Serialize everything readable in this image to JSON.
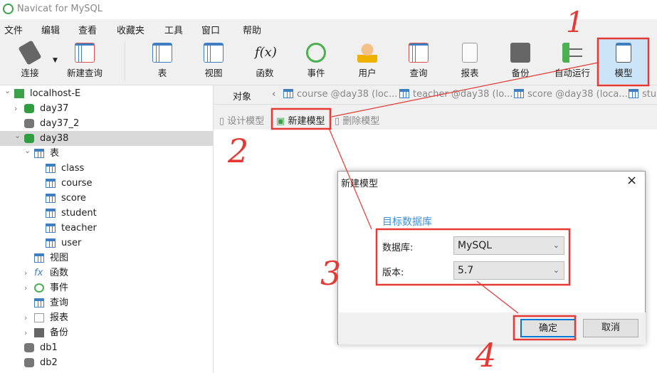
{
  "window": {
    "title": "Navicat for MySQL"
  },
  "menu": [
    "文件",
    "编辑",
    "查看",
    "收藏夹",
    "工具",
    "窗口",
    "帮助"
  ],
  "toolbar": [
    {
      "label": "连接",
      "icon": "connect-icon"
    },
    {
      "label": "新建查询",
      "icon": "new-query-icon"
    },
    {
      "label": "表",
      "icon": "table-icon"
    },
    {
      "label": "视图",
      "icon": "view-icon"
    },
    {
      "label": "函数",
      "icon": "function-icon"
    },
    {
      "label": "事件",
      "icon": "event-clock-icon"
    },
    {
      "label": "用户",
      "icon": "user-icon"
    },
    {
      "label": "查询",
      "icon": "query-icon"
    },
    {
      "label": "报表",
      "icon": "report-icon"
    },
    {
      "label": "备份",
      "icon": "backup-icon"
    },
    {
      "label": "自动运行",
      "icon": "auto-run-icon"
    },
    {
      "label": "模型",
      "icon": "model-icon",
      "active": true
    }
  ],
  "tree": [
    {
      "label": "localhost-E",
      "level": 0,
      "arrow": "v",
      "icon": "connection"
    },
    {
      "label": "day37",
      "level": 1,
      "arrow": ">",
      "icon": "db-green"
    },
    {
      "label": "day37_2",
      "level": 1,
      "arrow": "",
      "icon": "db-gray"
    },
    {
      "label": "day38",
      "level": 1,
      "arrow": "v",
      "icon": "db-green",
      "selected": true
    },
    {
      "label": "表",
      "level": 2,
      "arrow": "v",
      "icon": "table"
    },
    {
      "label": "class",
      "level": 3,
      "arrow": "",
      "icon": "table"
    },
    {
      "label": "course",
      "level": 3,
      "arrow": "",
      "icon": "table"
    },
    {
      "label": "score",
      "level": 3,
      "arrow": "",
      "icon": "table"
    },
    {
      "label": "student",
      "level": 3,
      "arrow": "",
      "icon": "table"
    },
    {
      "label": "teacher",
      "level": 3,
      "arrow": "",
      "icon": "table"
    },
    {
      "label": "user",
      "level": 3,
      "arrow": "",
      "icon": "table"
    },
    {
      "label": "视图",
      "level": 2,
      "arrow": "",
      "icon": "view"
    },
    {
      "label": "函数",
      "level": 2,
      "arrow": ">",
      "icon": "function"
    },
    {
      "label": "事件",
      "level": 2,
      "arrow": ">",
      "icon": "event"
    },
    {
      "label": "查询",
      "level": 2,
      "arrow": "",
      "icon": "query"
    },
    {
      "label": "报表",
      "level": 2,
      "arrow": ">",
      "icon": "report"
    },
    {
      "label": "备份",
      "level": 2,
      "arrow": ">",
      "icon": "backup"
    },
    {
      "label": "db1",
      "level": 1,
      "arrow": "",
      "icon": "db-gray"
    },
    {
      "label": "db2",
      "level": 1,
      "arrow": "",
      "icon": "db-gray"
    }
  ],
  "tabs": {
    "objects": "对象",
    "items": [
      "course @day38 (loc...",
      "teacher @day38 (lo...",
      "score @day38 (loca...",
      "stu"
    ]
  },
  "subtoolbar": {
    "design": "设计模型",
    "new": "新建模型",
    "delete": "删除模型"
  },
  "dialog": {
    "title": "新建模型",
    "section": "目标数据库",
    "db_label": "数据库:",
    "db_value": "MySQL",
    "ver_label": "版本:",
    "ver_value": "5.7",
    "ok": "确定",
    "cancel": "取消"
  },
  "annotations": [
    "1",
    "2",
    "3",
    "4"
  ],
  "colors": {
    "annotation": "#e53935",
    "accent": "#3d8fd6",
    "active_bg": "#cce4f7"
  }
}
